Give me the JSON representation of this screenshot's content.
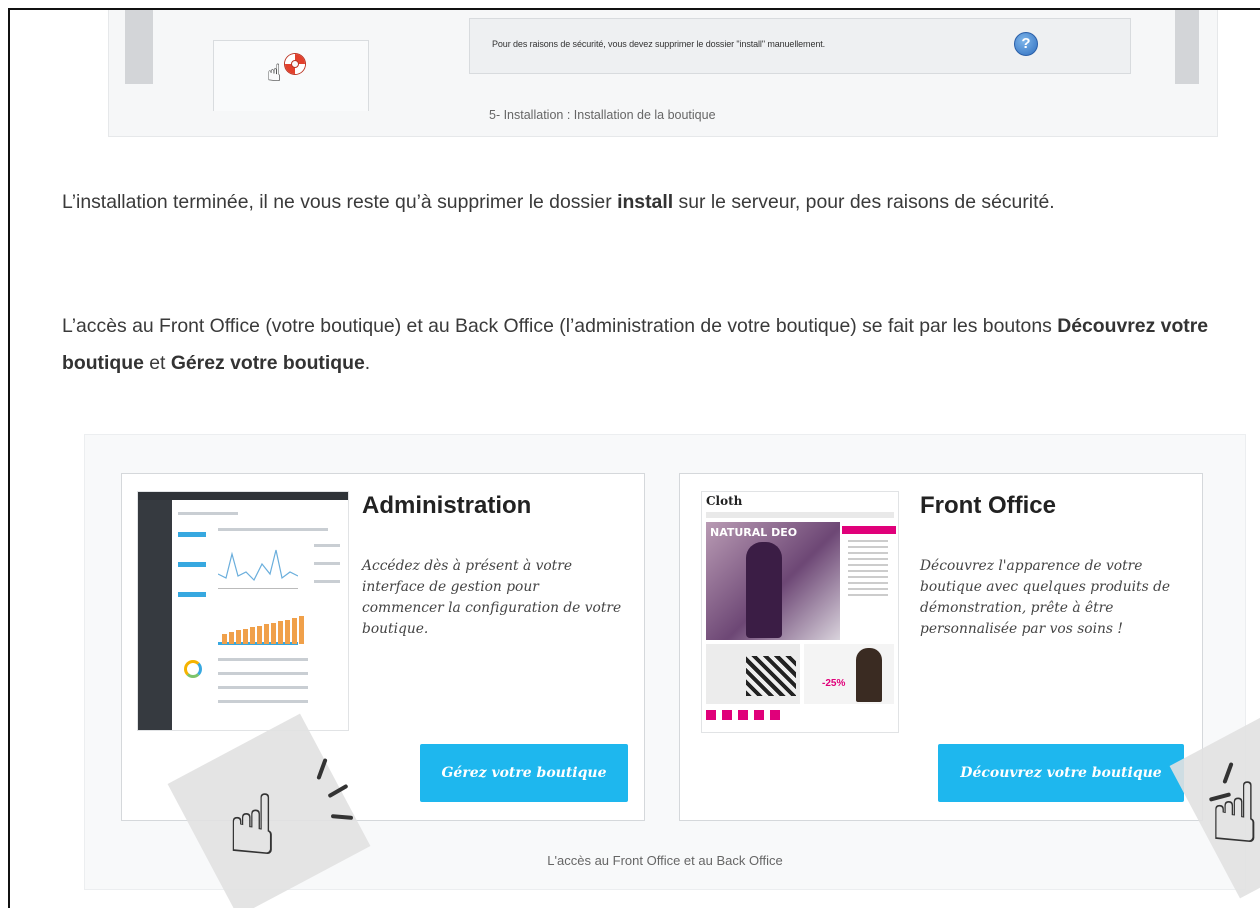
{
  "top_screenshot": {
    "notice_text": "Pour des raisons de sécurité, vous devez supprimer le dossier \"install\" manuellement.",
    "help_icon_glyph": "?",
    "caption": "5- Installation : Installation de la boutique"
  },
  "paragraph1": {
    "text_before": "L’installation terminée, il ne vous reste qu’à supprimer le dossier ",
    "bold": "install",
    "text_after": " sur le serveur, pour des raisons de sécurité."
  },
  "paragraph2": {
    "text_before": "L’accès au Front Office (votre boutique) et au Back Office (l’administration de votre boutique) se fait par les boutons ",
    "bold1": "Découvrez votre boutique",
    "text_middle": " et ",
    "bold2": "Gérez votre boutique",
    "text_after": "."
  },
  "cards": {
    "admin": {
      "title": "Administration",
      "description": "Accédez dès à présent à votre interface de gestion pour commencer la configuration de votre boutique.",
      "button_label": "Gérez votre boutique"
    },
    "front": {
      "title": "Front Office",
      "description": "Découvrez l'apparence de votre boutique avec quelques produits de démonstration, prête à être personnalisée par vos soins !",
      "button_label": "Découvrez votre boutique",
      "thumbnail_logo": "Cloth",
      "thumbnail_hero": "NATURAL DEO",
      "thumbnail_sale": "-25%"
    }
  },
  "bottom_caption": "L'accès au Front Office et au Back Office",
  "colors": {
    "button_blue": "#1eb7ee",
    "accent_pink": "#e0007a",
    "text": "#3a3a3a"
  },
  "icons": [
    "lifebuoy-icon",
    "hand-cursor-icon",
    "help-icon",
    "tap-hand-icon"
  ]
}
